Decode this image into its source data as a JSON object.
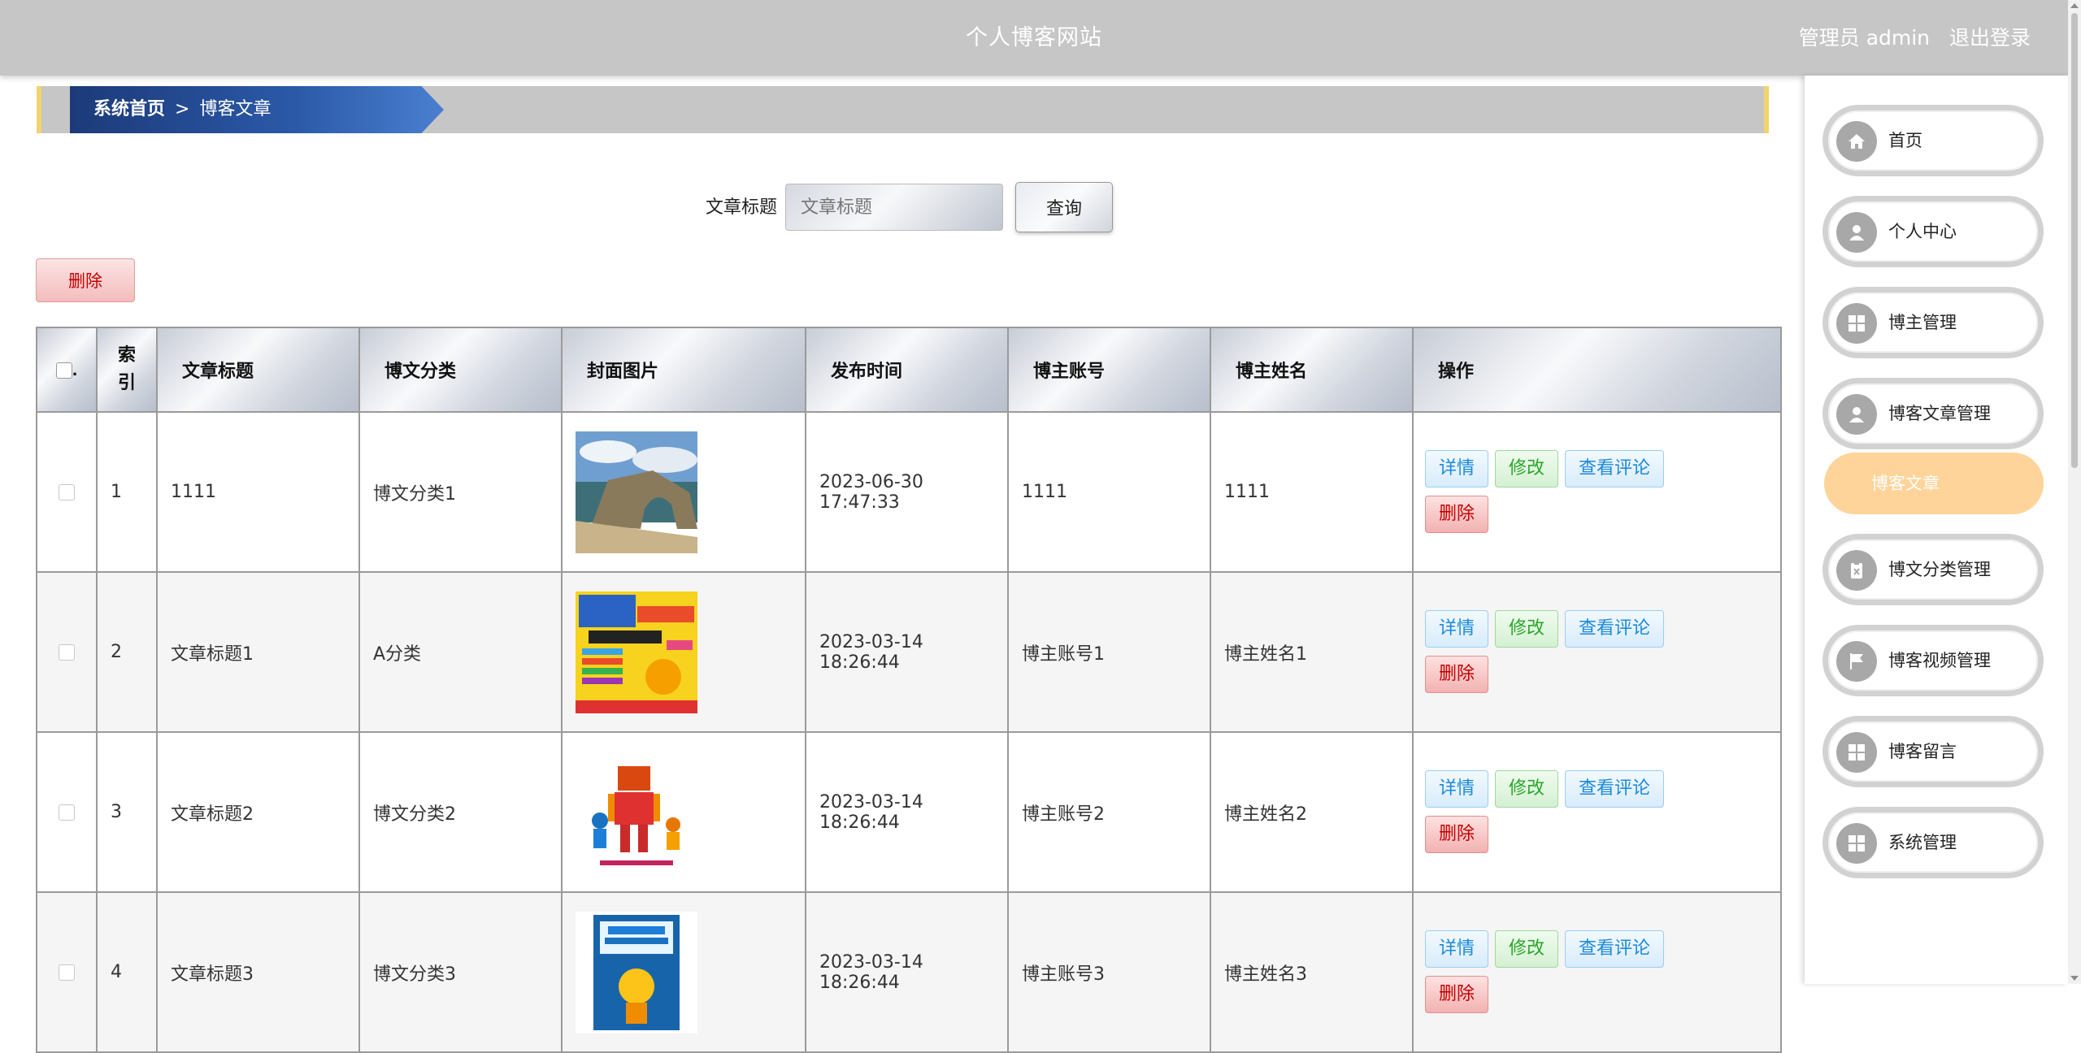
{
  "header": {
    "site_title": "个人博客网站",
    "user_label": "管理员 admin",
    "logout_label": "退出登录"
  },
  "breadcrumb": {
    "home": "系统首页",
    "separator": ">",
    "current": "博客文章"
  },
  "search": {
    "label": "文章标题",
    "placeholder": "文章标题",
    "button_label": "查询"
  },
  "toolbar": {
    "delete_label": "删除"
  },
  "table": {
    "headers": {
      "index": "索\n引",
      "title": "文章标题",
      "category": "博文分类",
      "cover": "封面图片",
      "time": "发布时间",
      "account": "博主账号",
      "name": "博主姓名",
      "ops": "操作"
    },
    "actions": {
      "detail": "详情",
      "edit": "修改",
      "comments": "查看评论",
      "delete": "删除"
    },
    "rows": [
      {
        "index": "1",
        "title": "1111",
        "category": "博文分类1",
        "cover": "coastal-arch-photo",
        "time": "2023-06-30 17:47:33",
        "account": "1111",
        "name": "1111"
      },
      {
        "index": "2",
        "title": "文章标题1",
        "category": "A分类",
        "cover": "scratch-book-cover",
        "time": "2023-03-14 18:26:44",
        "account": "博主账号1",
        "name": "博主姓名1"
      },
      {
        "index": "3",
        "title": "文章标题2",
        "category": "博文分类2",
        "cover": "robot-book-cover",
        "time": "2023-03-14 18:26:44",
        "account": "博主账号2",
        "name": "博主姓名2"
      },
      {
        "index": "4",
        "title": "文章标题3",
        "category": "博文分类3",
        "cover": "pytorch-book-cover",
        "time": "2023-03-14 18:26:44",
        "account": "博主账号3",
        "name": "博主姓名3"
      }
    ]
  },
  "sidebar": {
    "items": [
      {
        "label": "首页",
        "icon": "home-icon"
      },
      {
        "label": "个人中心",
        "icon": "person-icon"
      },
      {
        "label": "博主管理",
        "icon": "grid-icon"
      },
      {
        "label": "博客文章管理",
        "icon": "person-icon"
      },
      {
        "label": "博文分类管理",
        "icon": "clipboard-icon"
      },
      {
        "label": "博客视频管理",
        "icon": "flag-icon"
      },
      {
        "label": "博客留言",
        "icon": "grid-icon"
      },
      {
        "label": "系统管理",
        "icon": "grid-icon"
      }
    ],
    "active_sub": {
      "label": "博客文章"
    }
  },
  "colors": {
    "topbar": "#c6c6c6",
    "breadcrumb_accent": "#f2d46c",
    "breadcrumb_active": "#2b59a8",
    "active_submenu": "#ffd49a"
  }
}
